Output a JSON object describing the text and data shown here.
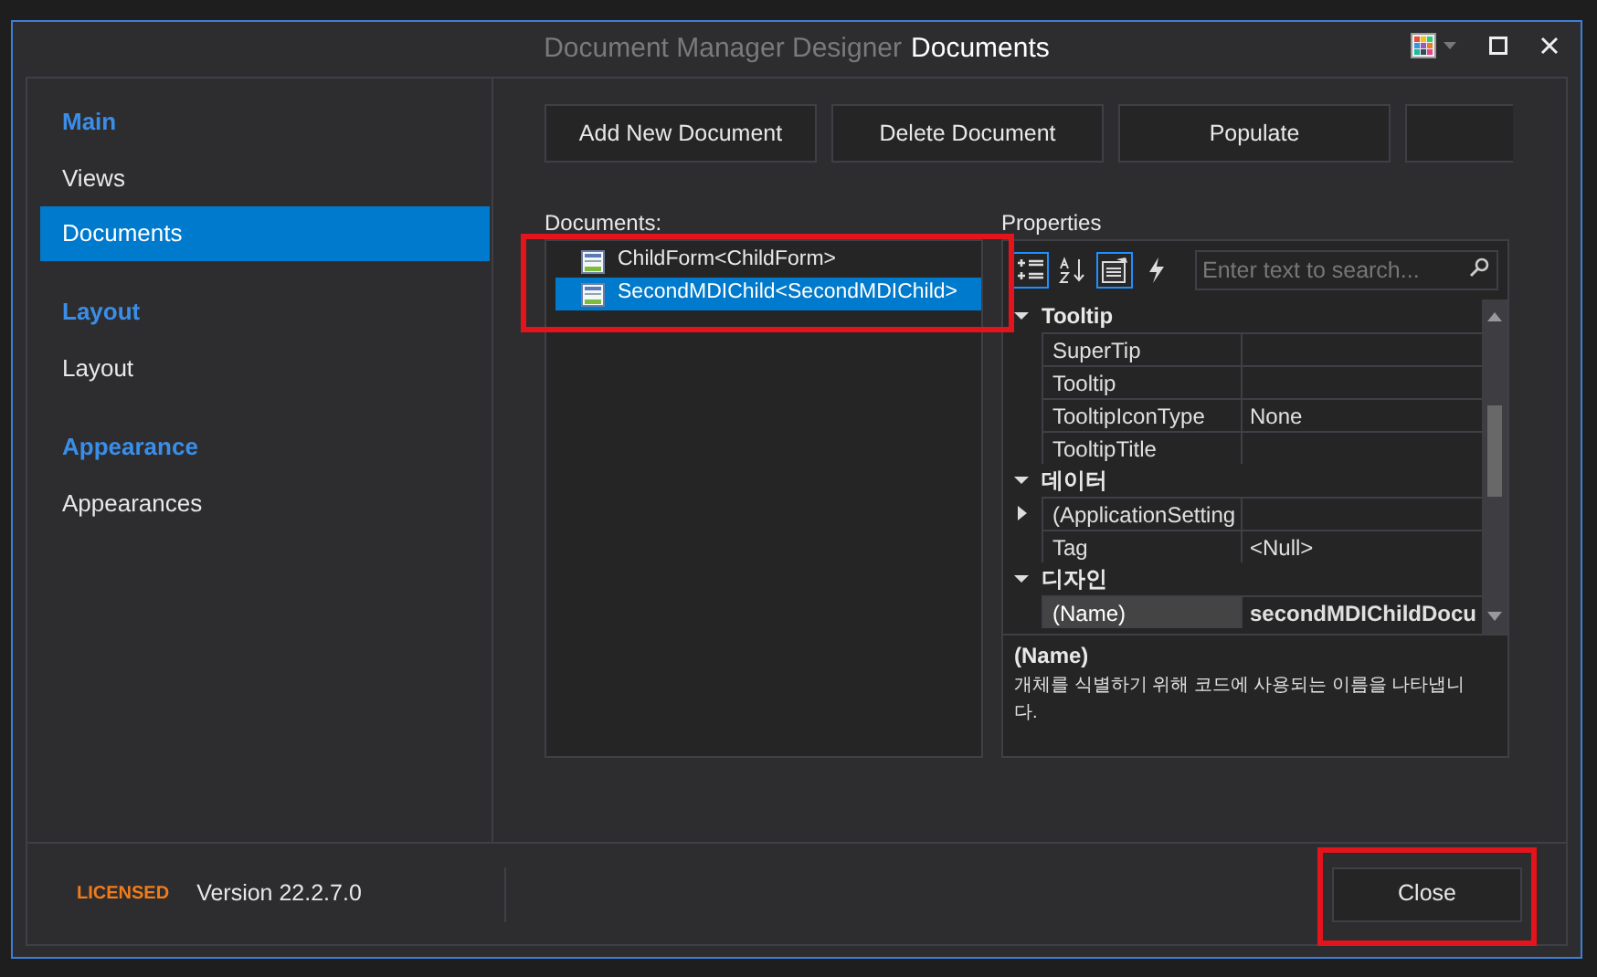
{
  "window": {
    "title_prefix": "Document Manager Designer",
    "title": "Documents"
  },
  "sidebar": {
    "groups": [
      {
        "title": "Main",
        "items": [
          {
            "label": "Views",
            "selected": false
          },
          {
            "label": "Documents",
            "selected": true
          }
        ]
      },
      {
        "title": "Layout",
        "items": [
          {
            "label": "Layout",
            "selected": false
          }
        ]
      },
      {
        "title": "Appearance",
        "items": [
          {
            "label": "Appearances",
            "selected": false
          }
        ]
      }
    ]
  },
  "toolbar": {
    "buttons": [
      "Add New Document",
      "Delete Document",
      "Populate"
    ],
    "cut_off_button": true
  },
  "documents": {
    "label": "Documents:",
    "items": [
      {
        "label": "ChildForm<ChildForm>",
        "selected": false
      },
      {
        "label": "SecondMDIChild<SecondMDIChild>",
        "selected": true
      }
    ],
    "highlighted": true
  },
  "properties": {
    "label": "Properties",
    "search_placeholder": "Enter text to search...",
    "tools": [
      {
        "kind": "categorized",
        "selected": true
      },
      {
        "kind": "alphabetical",
        "selected": false
      },
      {
        "kind": "pages",
        "selected": true
      },
      {
        "kind": "events",
        "selected": false
      }
    ],
    "categories": [
      {
        "name": "Tooltip",
        "expanded": true,
        "rows": [
          {
            "name": "SuperTip",
            "value": "",
            "selected": false
          },
          {
            "name": "Tooltip",
            "value": "",
            "selected": false
          },
          {
            "name": "TooltipIconType",
            "value": "None",
            "selected": false
          },
          {
            "name": "TooltipTitle",
            "value": "",
            "selected": false
          }
        ]
      },
      {
        "name": "데이터",
        "expanded": true,
        "rows": [
          {
            "name": "(ApplicationSetting",
            "value": "",
            "selected": false,
            "expandable": true
          },
          {
            "name": "Tag",
            "value": "<Null>",
            "selected": false
          }
        ]
      },
      {
        "name": "디자인",
        "expanded": true,
        "rows": [
          {
            "name": "(Name)",
            "value": "secondMDIChildDocu",
            "selected": true
          }
        ]
      }
    ],
    "description": {
      "title": "(Name)",
      "text": "개체를 식별하기 위해 코드에 사용되는 이름을 나타냅니다."
    }
  },
  "footer": {
    "license": "LICENSED",
    "version": "Version 22.2.7.0",
    "close": "Close",
    "close_highlighted": true
  }
}
